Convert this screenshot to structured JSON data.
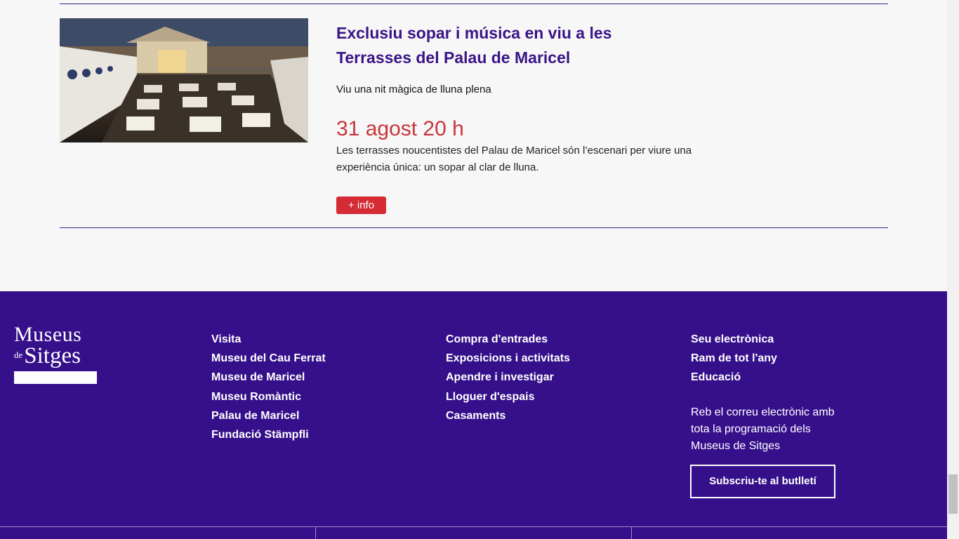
{
  "event": {
    "image_alt": "Terrasses del Palau de Maricel at dusk",
    "title": "Exclusiu sopar i música en viu a les Terrasses del Palau de Maricel",
    "subtitle": "Viu una nit màgica de lluna plena",
    "date": "31 agost 20 h",
    "description": "Les terrasses noucentistes del Palau de Maricel són l’escenari per viure una experiència única: un sopar al clar de lluna.",
    "info_button": "+ info"
  },
  "footer": {
    "logo": {
      "line1": "Museus",
      "de": "de",
      "line2": "Sitges"
    },
    "col1": [
      "Visita",
      "Museu del Cau Ferrat",
      "Museu de Maricel",
      "Museu Romàntic",
      "Palau de Maricel",
      "Fundació Stämpfli"
    ],
    "col2": [
      "Compra d'entrades",
      "Exposicions i activitats",
      "Apendre i investigar",
      "Lloguer d'espais",
      "Casaments"
    ],
    "col3": [
      "Seu electrònica",
      "Ram de tot l'any",
      "Educació"
    ],
    "newsletter_text": "Reb el correu electrònic amb tota la programació dels Museus de Sitges",
    "subscribe_button": "Subscriu-te al butlletí"
  },
  "colors": {
    "title_purple": "#3a1487",
    "date_red": "#c9353b",
    "button_red": "#d52b35",
    "footer_bg": "#36108b"
  }
}
